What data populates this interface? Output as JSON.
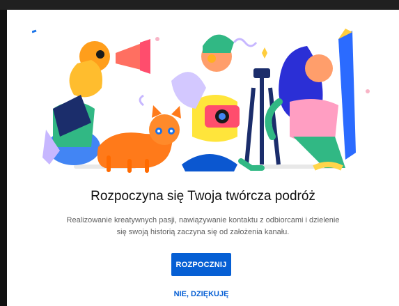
{
  "dialog": {
    "title": "Rozpoczyna się Twoja twórcza podróż",
    "description_line1": "Realizowanie kreatywnych pasji, nawiązywanie kontaktu z odbiorcami i dzielenie",
    "description_line2": "się swoją historią zaczyna się od założenia kanału.",
    "primary_button": "ROZPOCZNIJ",
    "secondary_button": "NIE, DZIĘKUJĘ"
  },
  "colors": {
    "accent": "#065fd4",
    "title": "#0f0f0f",
    "description": "#606060"
  },
  "illustration": {
    "name": "creators-illustration"
  }
}
